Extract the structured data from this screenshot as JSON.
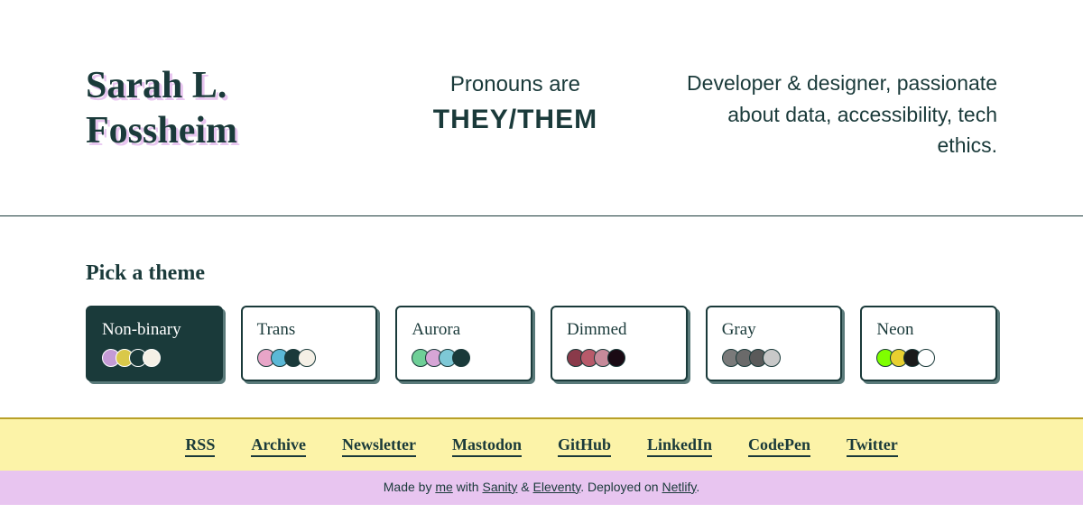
{
  "header": {
    "name_line1": "Sarah L.",
    "name_line2": "Fossheim",
    "pronouns_label": "Pronouns are",
    "pronouns_value": "THEY/THEM",
    "bio": "Developer & designer, passionate about data, accessibility, tech ethics."
  },
  "theme_picker": {
    "title": "Pick a theme",
    "themes": [
      {
        "name": "Non-binary",
        "active": true,
        "colors": [
          "#c49bd6",
          "#d9c84a",
          "#1a3a3a",
          "#f5f0e6"
        ]
      },
      {
        "name": "Trans",
        "active": false,
        "colors": [
          "#e8a5c8",
          "#5bb8d6",
          "#1a3a3a",
          "#f5f0e6"
        ]
      },
      {
        "name": "Aurora",
        "active": false,
        "colors": [
          "#6fcf97",
          "#d6a5d6",
          "#7ec8d6",
          "#1a3a3a"
        ]
      },
      {
        "name": "Dimmed",
        "active": false,
        "colors": [
          "#8a3a4a",
          "#b85a6a",
          "#c78a9a",
          "#1a0a14"
        ]
      },
      {
        "name": "Gray",
        "active": false,
        "colors": [
          "#7a7a7a",
          "#6a6a6a",
          "#5a5a5a",
          "#c8c8c8"
        ]
      },
      {
        "name": "Neon",
        "active": false,
        "colors": [
          "#7fff00",
          "#e8d030",
          "#1a1a1a",
          "#ffffff"
        ]
      }
    ]
  },
  "footer": {
    "links": [
      "RSS",
      "Archive",
      "Newsletter",
      "Mastodon",
      "GitHub",
      "LinkedIn",
      "CodePen",
      "Twitter"
    ],
    "credits": {
      "prefix": "Made by ",
      "me": "me",
      "middle1": " with ",
      "sanity": "Sanity",
      "amp": " & ",
      "eleventy": "Eleventy",
      "middle2": ". Deployed on ",
      "netlify": "Netlify",
      "suffix": "."
    }
  }
}
